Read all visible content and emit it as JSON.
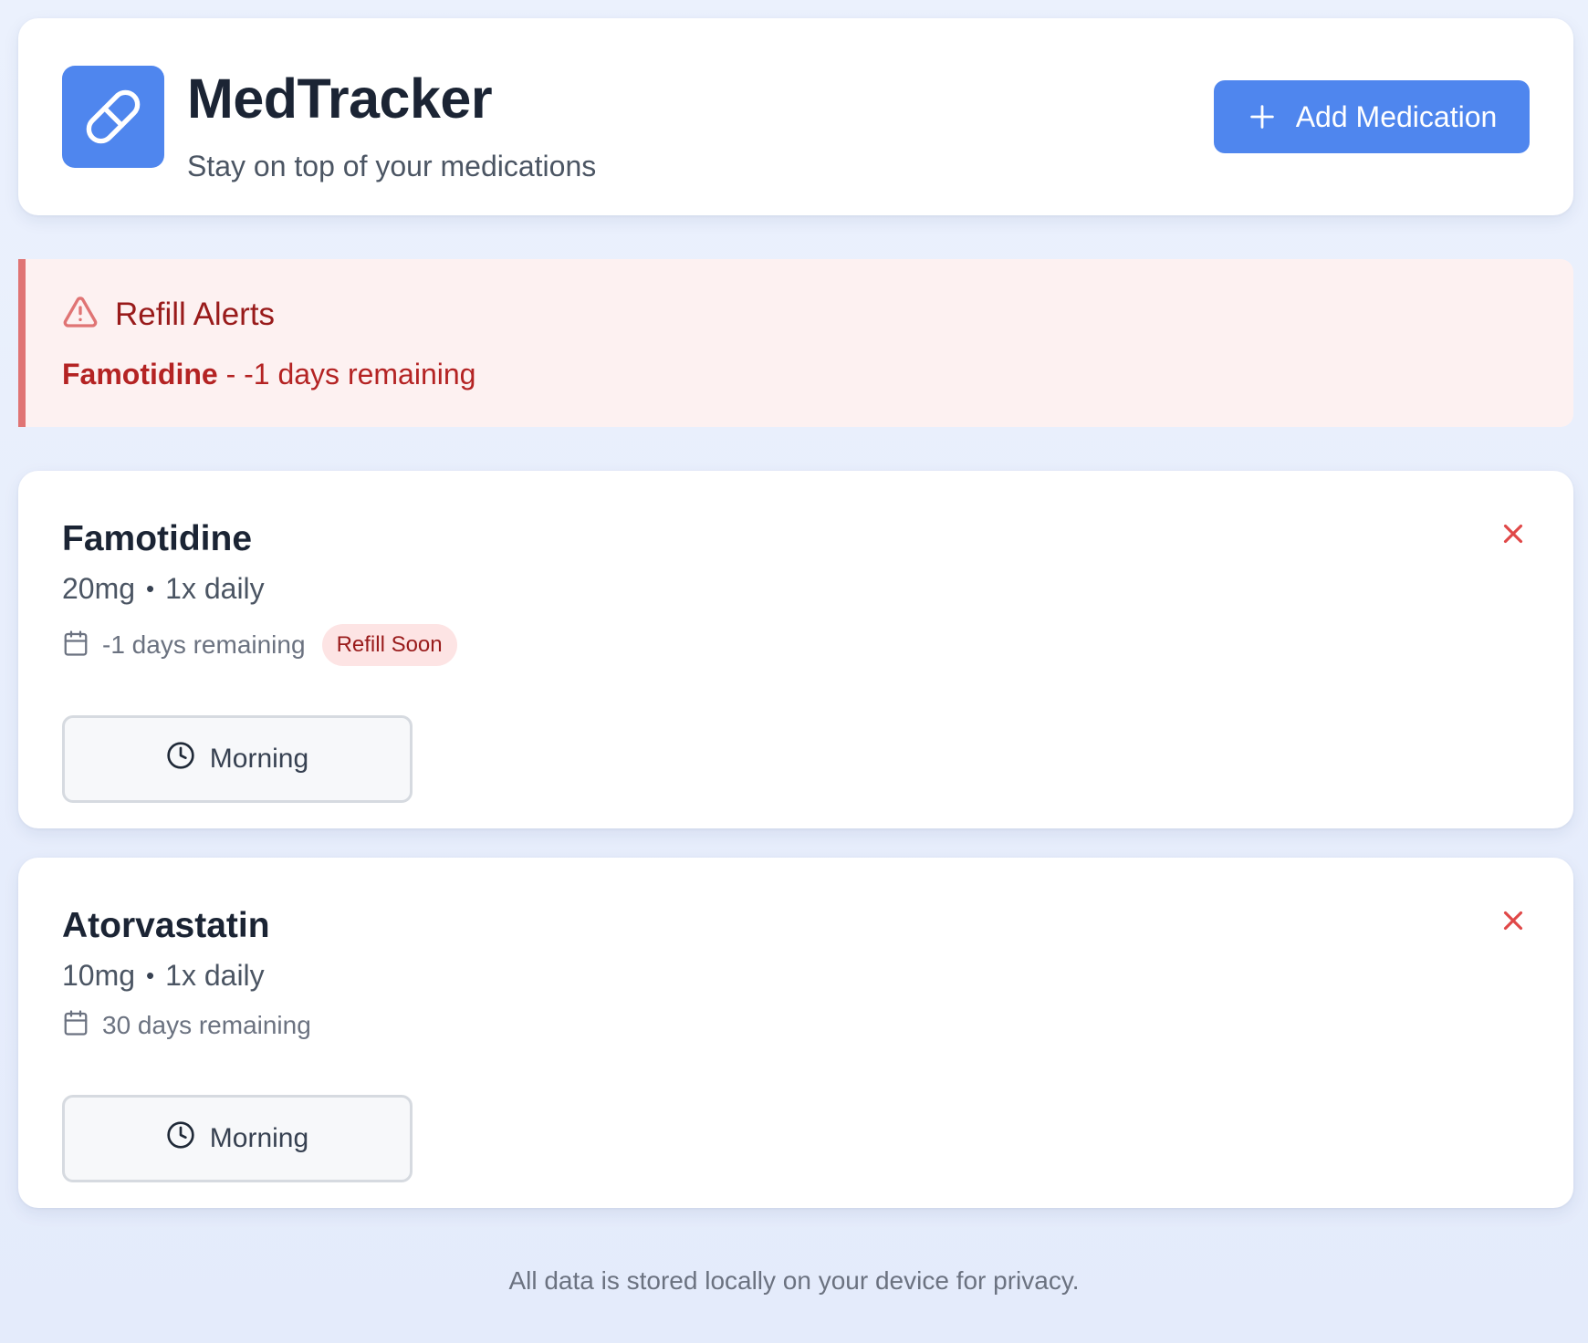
{
  "header": {
    "title": "MedTracker",
    "subtitle": "Stay on top of your medications",
    "add_button_label": "Add Medication",
    "logo_icon": "pill-icon",
    "accent_color": "#4f86ee"
  },
  "alerts": {
    "title": "Refill Alerts",
    "icon": "warning-triangle-icon",
    "items": [
      {
        "name": "Famotidine",
        "text": " - -1 days remaining"
      }
    ]
  },
  "medications": [
    {
      "name": "Famotidine",
      "dose": "20mg",
      "separator": "•",
      "frequency": "1x daily",
      "remaining": "-1 days remaining",
      "badge": "Refill Soon",
      "time_label": "Morning"
    },
    {
      "name": "Atorvastatin",
      "dose": "10mg",
      "separator": "•",
      "frequency": "1x daily",
      "remaining": "30 days remaining",
      "badge": "",
      "time_label": "Morning"
    }
  ],
  "footer": {
    "text": "All data is stored locally on your device for privacy."
  }
}
